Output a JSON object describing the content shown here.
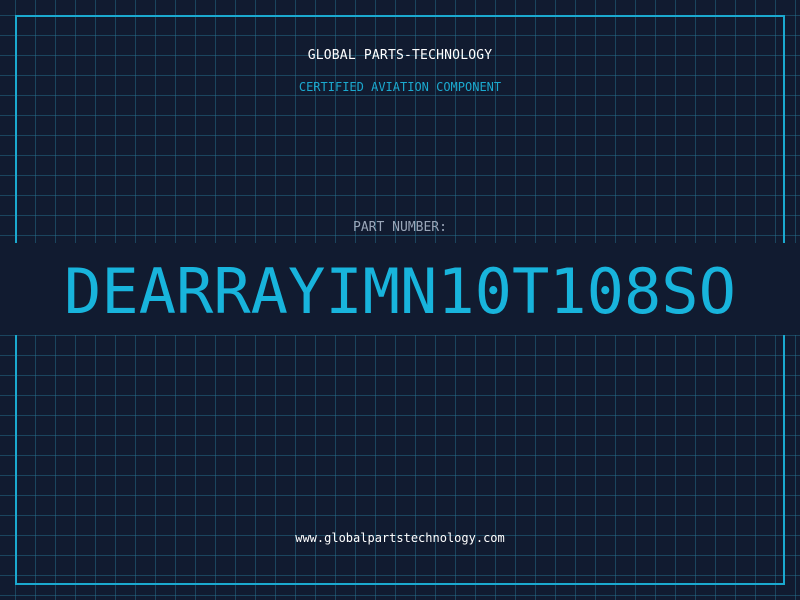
{
  "header": {
    "brand": "GLOBAL PARTS-TECHNOLOGY",
    "subtitle": "CERTIFIED AVIATION COMPONENT"
  },
  "part": {
    "label": "PART NUMBER:",
    "number": "DEARRAYIMN10T108SO"
  },
  "footer": {
    "url": "www.globalpartstechnology.com"
  },
  "colors": {
    "background": "#111b30",
    "grid": "#287896",
    "accent": "#1ba9cf",
    "text": "#ffffff",
    "label": "#9aa6b8"
  }
}
